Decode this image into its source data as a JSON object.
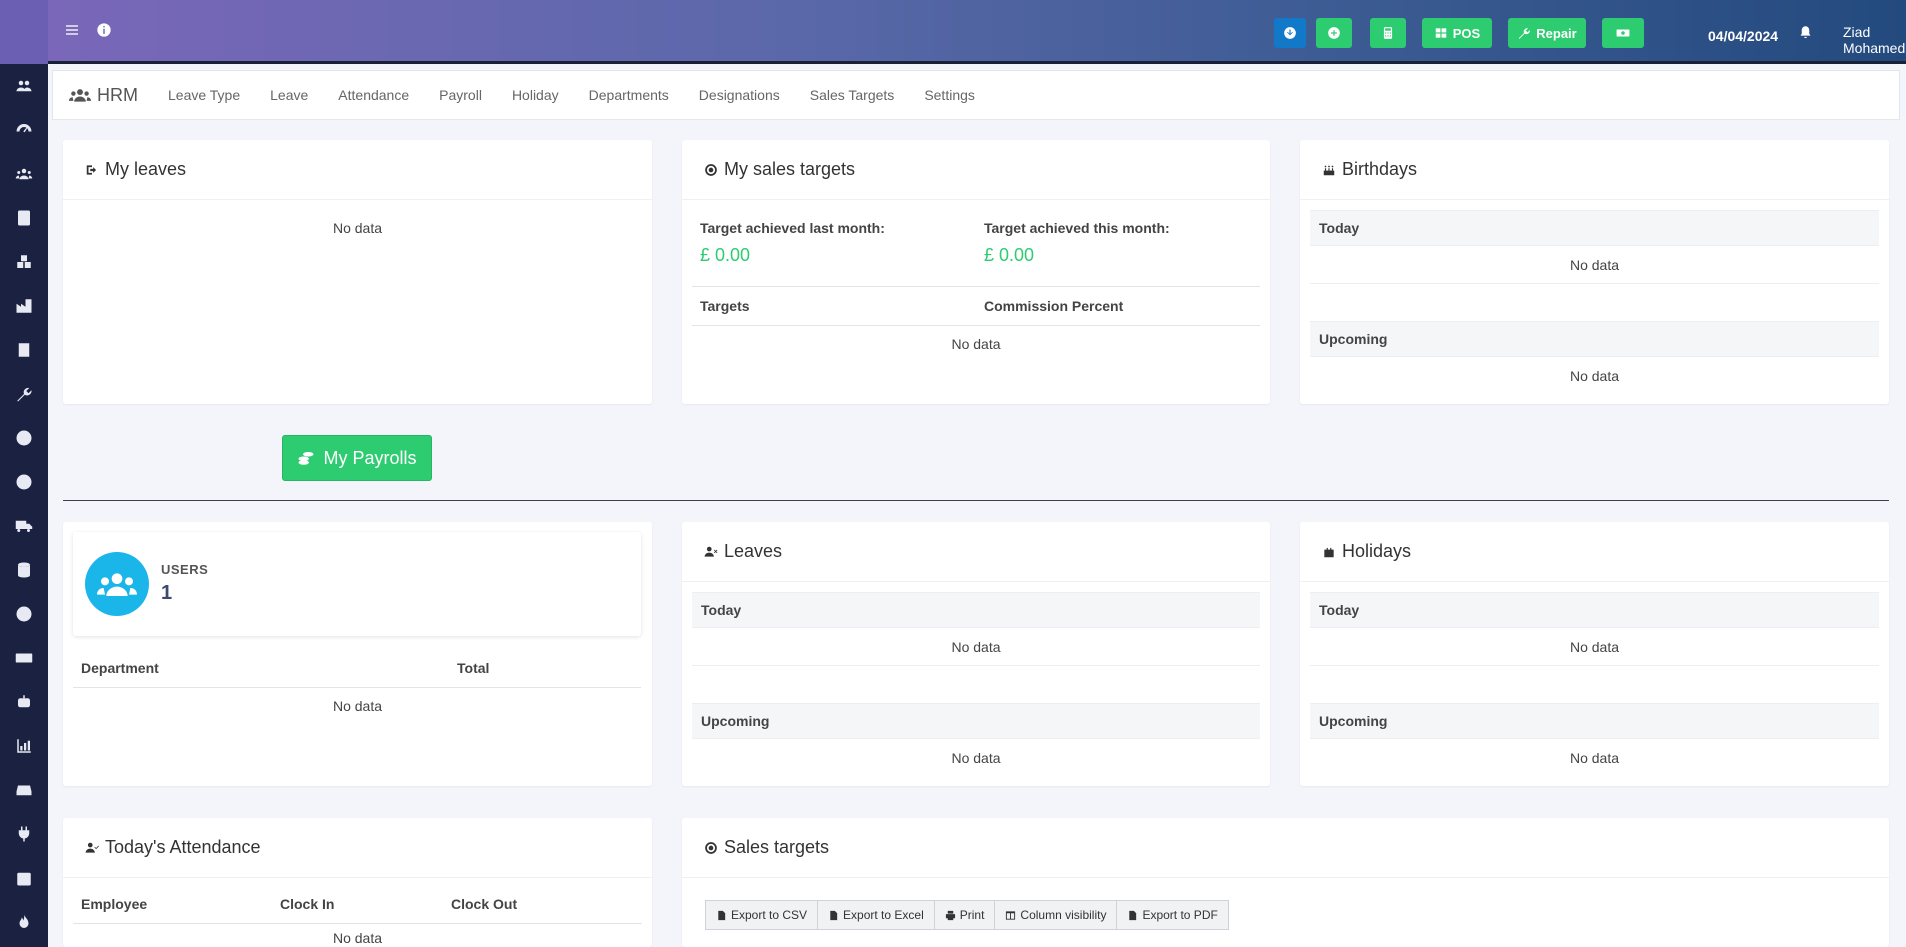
{
  "header": {
    "date": "04/04/2024",
    "user_name": "Ziad Mohamed",
    "pos_label": "POS",
    "repair_label": "Repair"
  },
  "module_nav": {
    "brand": "HRM",
    "items": [
      "Leave Type",
      "Leave",
      "Attendance",
      "Payroll",
      "Holiday",
      "Departments",
      "Designations",
      "Sales Targets",
      "Settings"
    ]
  },
  "my_leaves": {
    "title": "My leaves",
    "empty": "No data"
  },
  "my_sales_targets": {
    "title": "My sales targets",
    "last_month_label": "Target achieved last month:",
    "last_month_value": "£ 0.00",
    "this_month_label": "Target achieved this month:",
    "this_month_value": "£ 0.00",
    "col_targets": "Targets",
    "col_commission": "Commission Percent",
    "empty": "No data"
  },
  "birthdays": {
    "title": "Birthdays",
    "today": "Today",
    "today_empty": "No data",
    "upcoming": "Upcoming",
    "upcoming_empty": "No data"
  },
  "my_payrolls_button": "My Payrolls",
  "users_card": {
    "label": "USERS",
    "count": "1",
    "col_department": "Department",
    "col_total": "Total",
    "empty": "No data"
  },
  "leaves": {
    "title": "Leaves",
    "today": "Today",
    "today_empty": "No data",
    "upcoming": "Upcoming",
    "upcoming_empty": "No data"
  },
  "holidays": {
    "title": "Holidays",
    "today": "Today",
    "today_empty": "No data",
    "upcoming": "Upcoming",
    "upcoming_empty": "No data"
  },
  "todays_attendance": {
    "title": "Today's Attendance",
    "col_employee": "Employee",
    "col_clock_in": "Clock In",
    "col_clock_out": "Clock Out",
    "empty": "No data"
  },
  "sales_targets": {
    "title": "Sales targets",
    "export_csv": "Export to CSV",
    "export_excel": "Export to Excel",
    "print": "Print",
    "column_visibility": "Column visibility",
    "export_pdf": "Export to PDF"
  },
  "colors": {
    "accent_green": "#2ecc71",
    "accent_blue": "#1279c9",
    "sidebar_bg": "#1b2140",
    "users_circle": "#1ab6ea"
  }
}
